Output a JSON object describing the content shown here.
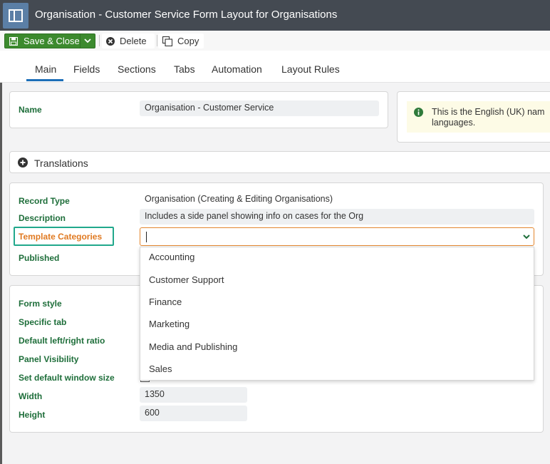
{
  "window": {
    "title": "Organisation - Customer Service Form Layout for Organisations",
    "app_icon": "layout-icon"
  },
  "toolbar": {
    "save_close_label": "Save & Close",
    "delete_label": "Delete",
    "copy_label": "Copy"
  },
  "tabs": [
    {
      "label": "Main",
      "active": true
    },
    {
      "label": "Fields",
      "active": false
    },
    {
      "label": "Sections",
      "active": false
    },
    {
      "label": "Tabs",
      "active": false
    },
    {
      "label": "Automation",
      "active": false
    },
    {
      "label": "Layout Rules",
      "active": false
    }
  ],
  "name_panel": {
    "label": "Name",
    "value": "Organisation - Customer Service"
  },
  "info": {
    "text": "This is the English (UK) nam languages."
  },
  "translations": {
    "title": "Translations"
  },
  "details": {
    "record_type_label": "Record Type",
    "record_type_value": "Organisation (Creating & Editing Organisations)",
    "description_label": "Description",
    "description_value": "Includes a side panel showing info on cases for the Org",
    "template_categories_label": "Template Categories",
    "template_categories_value": "",
    "published_label": "Published"
  },
  "dropdown_options": [
    "Accounting",
    "Customer Support",
    "Finance",
    "Marketing",
    "Media and Publishing",
    "Sales"
  ],
  "form": {
    "form_style_label": "Form style",
    "specific_tab_label": "Specific tab",
    "ratio_label": "Default left/right ratio",
    "panel_visibility_label": "Panel Visibility",
    "window_size_label": "Set default window size",
    "width_label": "Width",
    "width_value": "1350",
    "height_label": "Height",
    "height_value": "600"
  },
  "colors": {
    "titlebar": "#444a52",
    "save_button": "#3c8a2e",
    "label_green": "#1e6e3a",
    "accent_blue": "#1d6fb8",
    "focus_orange": "#e3862e",
    "highlight_teal": "#21a88c"
  }
}
